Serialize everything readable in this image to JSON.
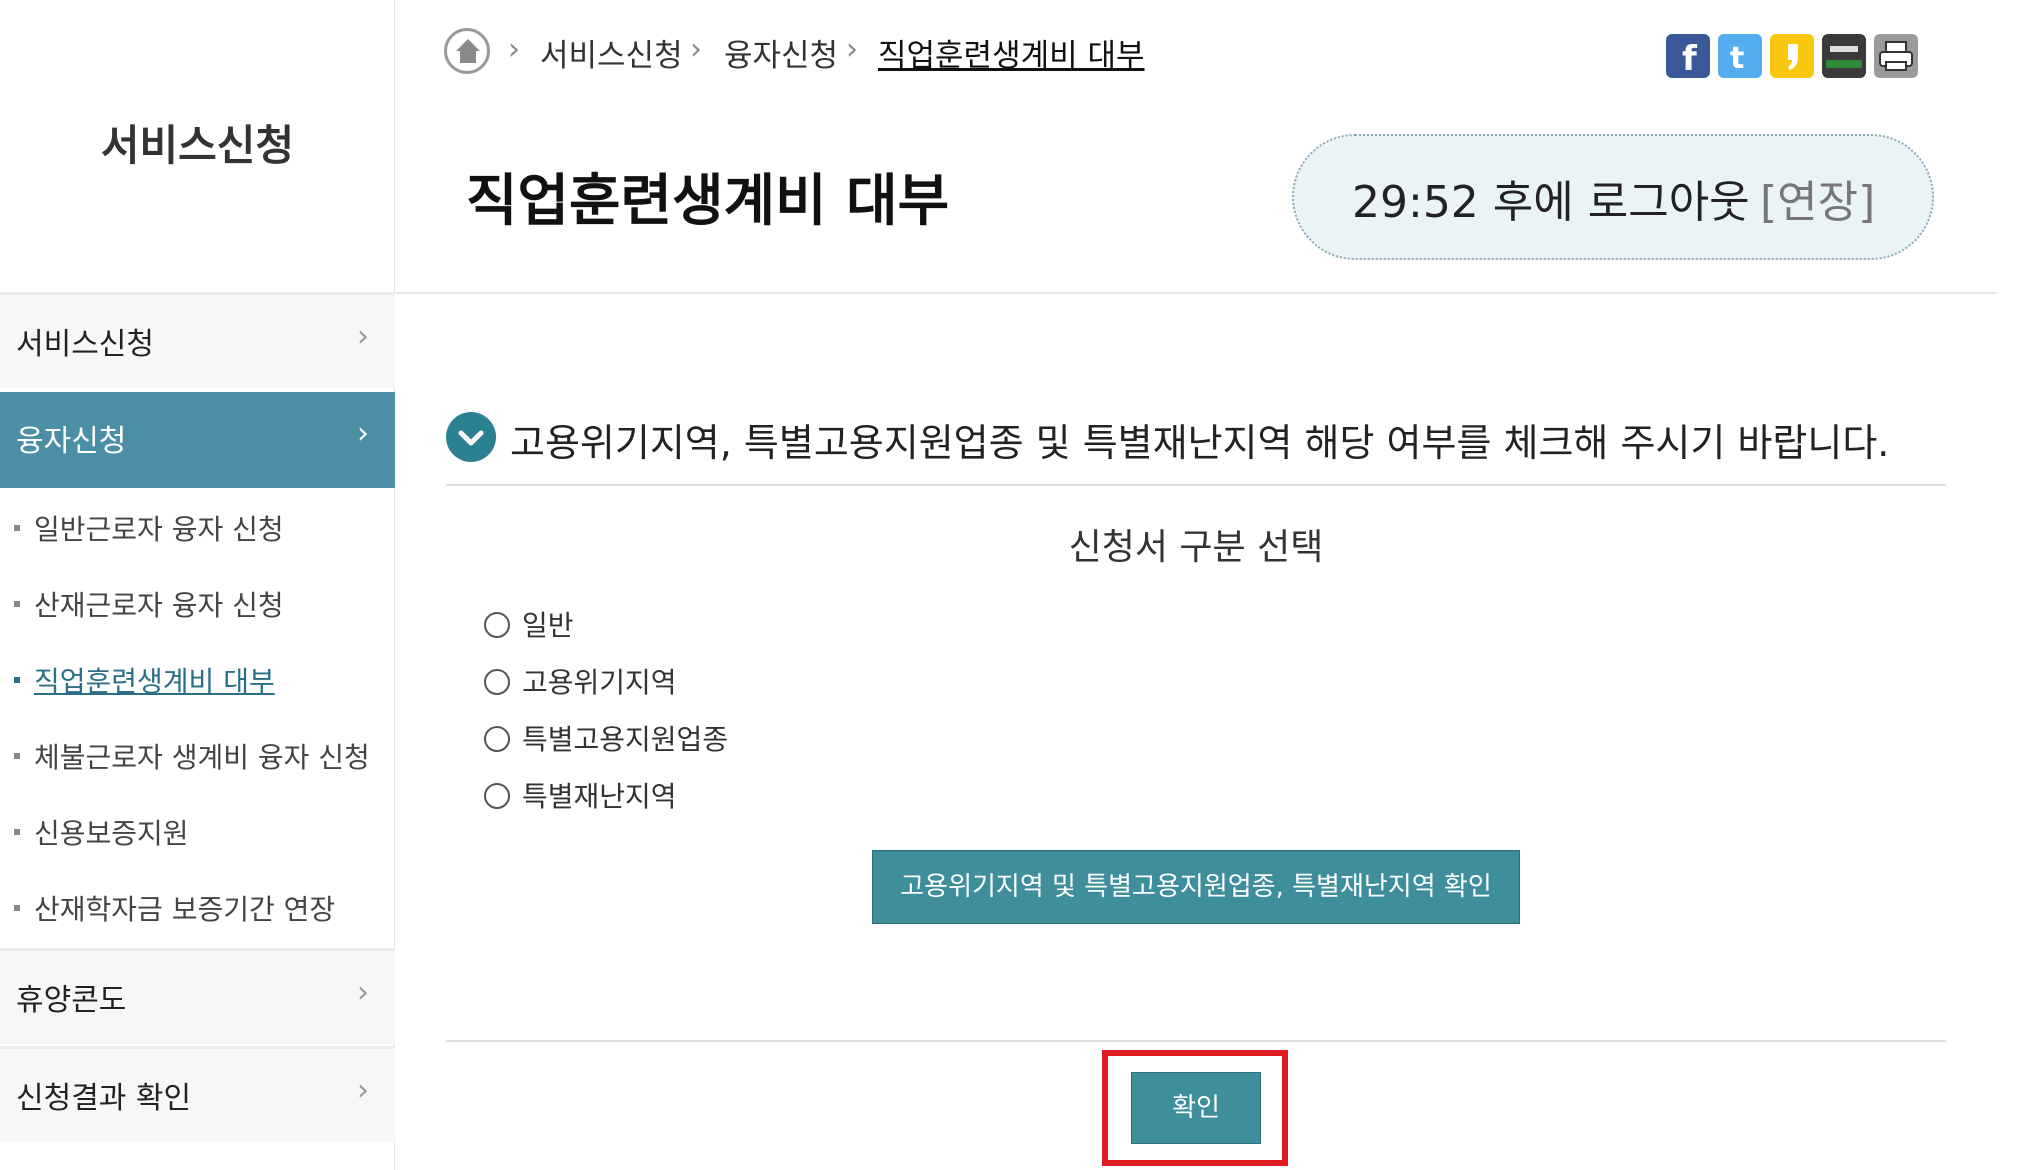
{
  "sidebar": {
    "title": "서비스신청",
    "menus": [
      {
        "label": "서비스신청",
        "chevron": "›"
      },
      {
        "label": "융자신청",
        "chevron": "›"
      },
      {
        "label": "휴양콘도",
        "chevron": "›"
      },
      {
        "label": "신청결과 확인",
        "chevron": "›"
      }
    ],
    "sub_items": [
      {
        "label": "일반근로자 융자 신청"
      },
      {
        "label": "산재근로자 융자 신청"
      },
      {
        "label": "직업훈련생계비 대부"
      },
      {
        "label": "체불근로자 생계비 융자 신청"
      },
      {
        "label": "신용보증지원"
      },
      {
        "label": "산재학자금 보증기간 연장"
      }
    ]
  },
  "breadcrumb": {
    "separator": "›",
    "items": [
      "서비스신청",
      "융자신청",
      "직업훈련생계비 대부"
    ]
  },
  "social": {
    "icons": [
      {
        "name": "facebook-icon",
        "color": "#3b5998"
      },
      {
        "name": "twitter-icon",
        "color": "#55acee"
      },
      {
        "name": "kakaostory-icon",
        "color": "#f9c80e"
      },
      {
        "name": "band-icon",
        "color": "#2f8a3b"
      },
      {
        "name": "print-icon",
        "color": "#9a9a9a"
      }
    ]
  },
  "page_title": "직업훈련생계비 대부",
  "session": {
    "time": "29:52 후에 로그아웃",
    "extend": "[연장]"
  },
  "notice": "고용위기지역, 특별고용지원업종 및 특별재난지역 해당 여부를 체크해 주시기 바랍니다.",
  "select_title": "신청서 구분 선택",
  "radio_options": [
    "일반",
    "고용위기지역",
    "특별고용지원업종",
    "특별재난지역"
  ],
  "region_check_button": "고용위기지역 및 특별고용지원업종, 특별재난지역 확인",
  "confirm_button": "확인",
  "colors": {
    "accent": "#4b8fa6",
    "button": "#3f8e9c",
    "highlight": "#e01b22"
  }
}
